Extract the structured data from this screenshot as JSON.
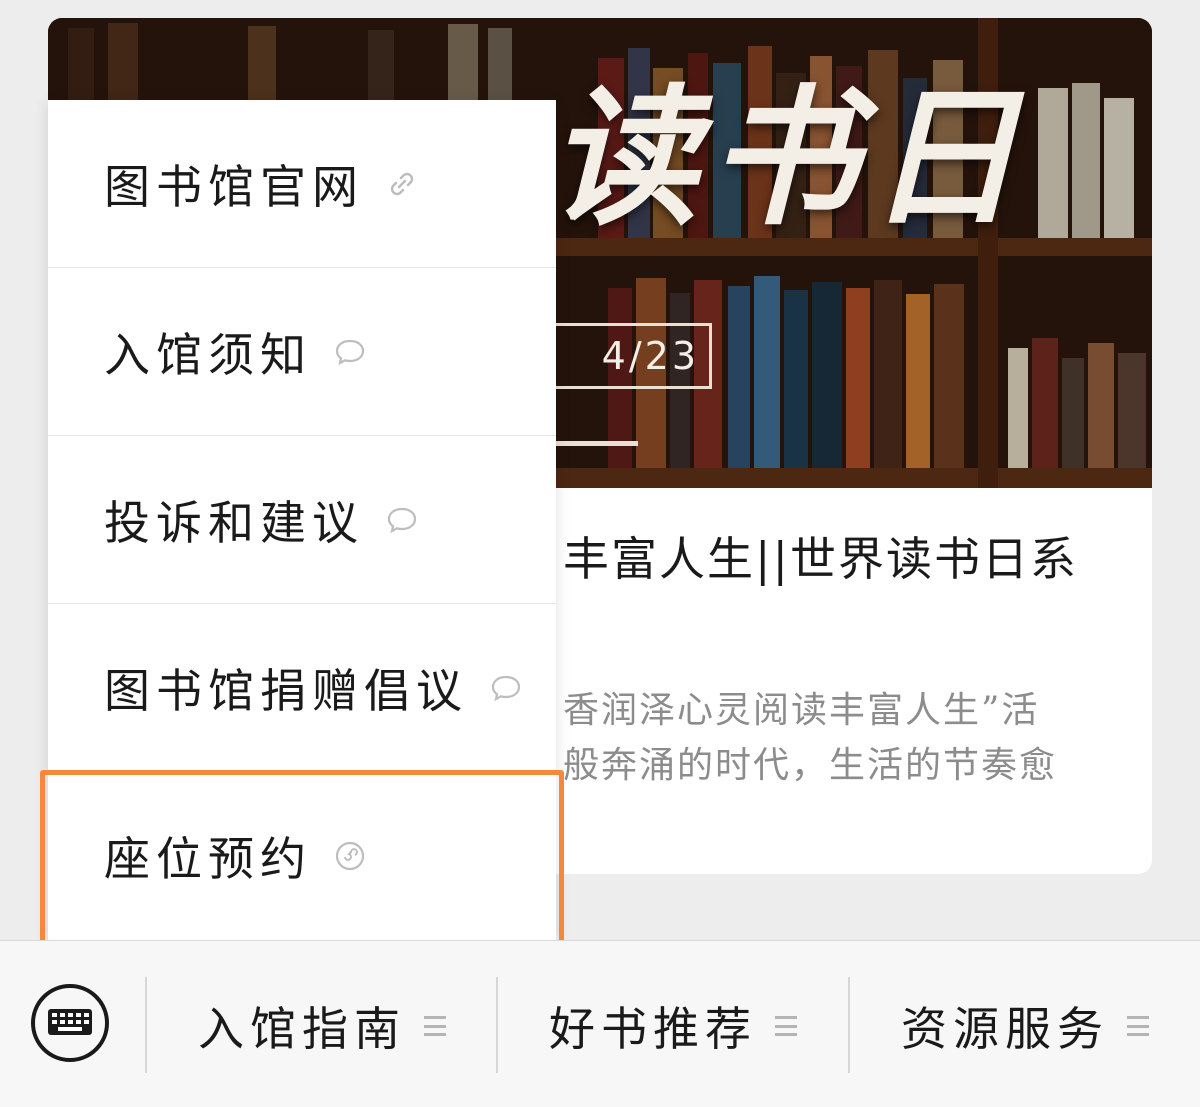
{
  "article": {
    "banner_title": "读书日",
    "banner_date": "4/23",
    "title": "丰富人生||世界读书日系",
    "summary_line1": "香润泽心灵阅读丰富人生”活",
    "summary_line2": "般奔涌的时代，生活的节奏愈"
  },
  "submenu": {
    "items": [
      {
        "label": "图书馆官网",
        "icon": "link-icon"
      },
      {
        "label": "入馆须知",
        "icon": "chat-bubble-icon"
      },
      {
        "label": "投诉和建议",
        "icon": "chat-bubble-icon"
      },
      {
        "label": "图书馆捐赠倡议",
        "icon": "chat-bubble-icon"
      },
      {
        "label": "座位预约",
        "icon": "mini-program-icon"
      }
    ],
    "highlighted_item": "座位预约",
    "highlight_color": "#f5883a"
  },
  "bottom_menu": {
    "keyboard_icon": "keyboard-icon",
    "tabs": [
      {
        "label": "入馆指南",
        "icon": "menu-lines-icon"
      },
      {
        "label": "好书推荐",
        "icon": "menu-lines-icon"
      },
      {
        "label": "资源服务",
        "icon": "menu-lines-icon"
      }
    ]
  }
}
